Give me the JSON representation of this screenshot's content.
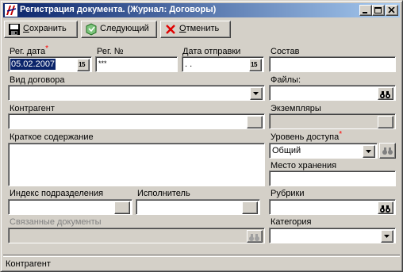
{
  "window": {
    "title": "Регистрация документа. (Журнал: Договоры)"
  },
  "toolbar": {
    "save_label_first": "С",
    "save_label_rest": "охранить",
    "next_label": "Следующий",
    "cancel_label_first": "О",
    "cancel_label_rest": "тменить"
  },
  "form": {
    "reg_date_label": "Рег. дата",
    "reg_date_value": "05.02.2007",
    "reg_num_label": "Рег. №",
    "reg_num_value": "***",
    "send_date_label": "Дата отправки",
    "send_date_value": " . .",
    "composition_label": "Состав",
    "composition_value": "",
    "contract_type_label": "Вид договора",
    "contract_type_value": "",
    "files_label": "Файлы:",
    "counterparty_label": "Контрагент",
    "counterparty_value": "",
    "copies_label": "Экземпляры",
    "summary_label": "Краткое содержание",
    "summary_value": "",
    "access_level_label": "Уровень доступа",
    "access_level_value": "Общий",
    "storage_label": "Место хранения",
    "storage_value": "",
    "dept_index_label": "Индекс подразделения",
    "executor_label": "Исполнитель",
    "rubrics_label": "Рубрики",
    "related_docs_label": "Связанные документы",
    "category_label": "Категория",
    "category_value": "",
    "calendar_glyph": "15",
    "required_mark": "*"
  },
  "statusbar": {
    "text": "Контрагент"
  },
  "colors": {
    "title_start": "#0a246a",
    "title_end": "#a6caf0",
    "face": "#d4d0c8",
    "required": "#ff0000"
  },
  "icons": {
    "app": "app-logo-icon",
    "save": "floppy-disk-icon",
    "next": "next-document-icon",
    "cancel": "red-x-icon",
    "calendar": "calendar-icon",
    "dropdown": "chevron-down-icon",
    "binoculars": "binoculars-icon"
  }
}
